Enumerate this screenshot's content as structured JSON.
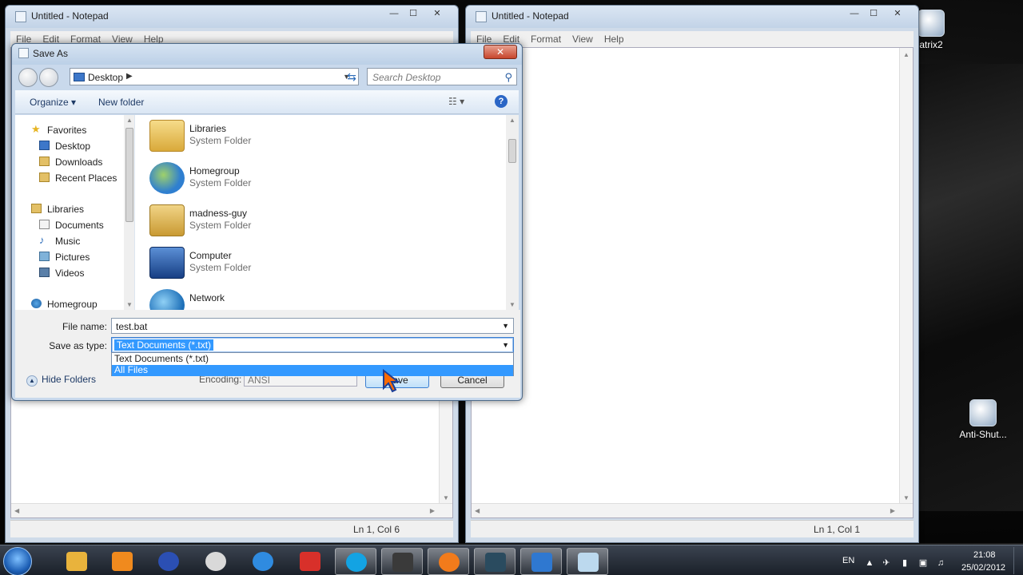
{
  "notepad_left": {
    "title": "Untitled - Notepad",
    "menu": [
      "File",
      "Edit",
      "Format",
      "View",
      "Help"
    ],
    "status": "Ln 1, Col 6"
  },
  "notepad_right": {
    "title": "Untitled - Notepad",
    "menu": [
      "File",
      "Edit",
      "Format",
      "View",
      "Help"
    ],
    "status": "Ln 1, Col 1"
  },
  "dialog": {
    "title": "Save As",
    "close_label": "✕",
    "address": "Desktop",
    "search_placeholder": "Search Desktop",
    "toolbar": {
      "organize": "Organize ▾",
      "new_folder": "New folder"
    },
    "nav": [
      {
        "label": "Favorites",
        "icon": "star-icon",
        "group": true
      },
      {
        "label": "Desktop",
        "icon": "desktop-icon"
      },
      {
        "label": "Downloads",
        "icon": "downloads-icon"
      },
      {
        "label": "Recent Places",
        "icon": "recent-places-icon"
      },
      {
        "label": "Libraries",
        "icon": "libraries-icon",
        "group": true
      },
      {
        "label": "Documents",
        "icon": "documents-icon"
      },
      {
        "label": "Music",
        "icon": "music-icon"
      },
      {
        "label": "Pictures",
        "icon": "pictures-icon"
      },
      {
        "label": "Videos",
        "icon": "videos-icon"
      },
      {
        "label": "Homegroup",
        "icon": "homegroup-icon",
        "group": true
      }
    ],
    "files": [
      {
        "name": "Libraries",
        "type": "System Folder",
        "icon": "libraries-folder-icon",
        "color": "#e8c35a"
      },
      {
        "name": "Homegroup",
        "type": "System Folder",
        "icon": "homegroup-icon",
        "color": "#3e8fd8"
      },
      {
        "name": "madness-guy",
        "type": "System Folder",
        "icon": "user-folder-icon",
        "color": "#d9b558"
      },
      {
        "name": "Computer",
        "type": "System Folder",
        "icon": "computer-icon",
        "color": "#2c5aa8"
      },
      {
        "name": "Network",
        "type": "",
        "icon": "network-icon",
        "color": "#2f8bd0"
      }
    ],
    "file_name_label": "File name:",
    "file_name_value": "test.bat",
    "save_as_type_label": "Save as type:",
    "save_as_type_value": "Text Documents (*.txt)",
    "type_options": [
      "Text Documents (*.txt)",
      "All Files"
    ],
    "encoding_label": "Encoding:",
    "encoding_value": "ANSI",
    "hide_folders": "Hide Folders",
    "save_button": "Save",
    "cancel_button": "Cancel"
  },
  "desktop_icons": [
    "atrix2",
    "Anti-Shut..."
  ],
  "taskbar": {
    "apps": [
      {
        "icon": "explorer-icon",
        "color": "#e9b33c"
      },
      {
        "icon": "media-player-icon",
        "color": "#f08a1e"
      },
      {
        "icon": "app-icon",
        "color": "#2b4fb3"
      },
      {
        "icon": "clock-icon",
        "color": "#d9d9d9"
      },
      {
        "icon": "internet-explorer-icon",
        "color": "#2f8be0"
      },
      {
        "icon": "pin-icon",
        "color": "#d8302a"
      },
      {
        "icon": "skype-icon",
        "color": "#13a3e3"
      },
      {
        "icon": "game-icon",
        "color": "#3a3a3a"
      },
      {
        "icon": "mail-icon",
        "color": "#f27b1b"
      },
      {
        "icon": "steam-icon",
        "color": "#2a4b5f"
      },
      {
        "icon": "gmod-icon",
        "color": "#2f78d0"
      },
      {
        "icon": "notepad-icon",
        "color": "#bcd9ee"
      }
    ],
    "language": "EN",
    "time": "21:08",
    "date": "25/02/2012"
  },
  "colors": {
    "selection": "#3399ff",
    "dialog_frame": "#c9d9ec",
    "taskbar": "#1a2029"
  }
}
